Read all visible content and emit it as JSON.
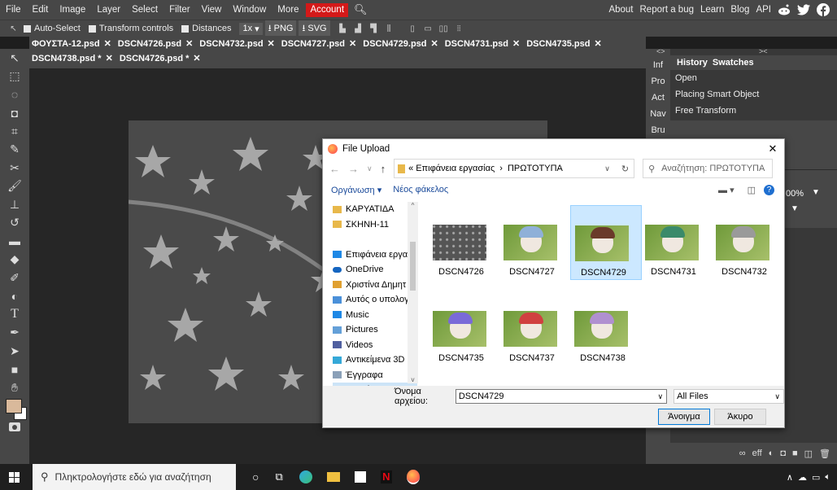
{
  "menubar": {
    "items": [
      "File",
      "Edit",
      "Image",
      "Layer",
      "Select",
      "Filter",
      "View",
      "Window",
      "More"
    ],
    "account": "Account",
    "right_items": [
      "About",
      "Report a bug",
      "Learn",
      "Blog",
      "API"
    ]
  },
  "optbar": {
    "auto_select": "Auto-Select",
    "transform_controls": "Transform controls",
    "distances": "Distances",
    "zoom": "1x",
    "png": "PNG",
    "svg": "SVG"
  },
  "tabs": {
    "row1": [
      "ΦΟΥΣΤΑ-12.psd",
      "DSCN4726.psd",
      "DSCN4732.psd",
      "DSCN4727.psd",
      "DSCN4729.psd",
      "DSCN4731.psd",
      "DSCN4735.psd"
    ],
    "row2": [
      "DSCN4738.psd *",
      "DSCN4726.psd *"
    ]
  },
  "right_panel": {
    "side_labels": [
      "Inf",
      "Pro",
      "Act",
      "Nav",
      "Bru"
    ],
    "tabs": [
      "History",
      "Swatches"
    ],
    "history": [
      "Open",
      "Placing Smart Object",
      "Free Transform"
    ],
    "zoom_fragment": "00%"
  },
  "dialog": {
    "title": "File Upload",
    "breadcrumb_prefix": "«",
    "breadcrumb": [
      "Επιφάνεια εργασίας",
      "ΠΡΩΤΟΤΥΠΑ"
    ],
    "search_placeholder": "Αναζήτηση: ΠΡΩΤΟΤΥΠΑ",
    "organize": "Οργάνωση ▾",
    "new_folder": "Νέος φάκελος",
    "tree": [
      {
        "label": "ΚΑΡΥΑΤΙΔΑ",
        "icon": "folder",
        "color": "#e8b84a"
      },
      {
        "label": "ΣΚΗΝΗ-11",
        "icon": "folder",
        "color": "#e8b84a"
      },
      {
        "label": "",
        "icon": "none",
        "color": "#ffffff"
      },
      {
        "label": "Επιφάνεια εργασί",
        "icon": "desktop",
        "color": "#1e88e5"
      },
      {
        "label": "OneDrive",
        "icon": "cloud",
        "color": "#1565c0"
      },
      {
        "label": "Χριστίνα Δημητ",
        "icon": "user",
        "color": "#e0a030"
      },
      {
        "label": "Αυτός ο υπολογ",
        "icon": "pc",
        "color": "#4a90d9"
      },
      {
        "label": "Music",
        "icon": "music",
        "color": "#1e88e5"
      },
      {
        "label": "Pictures",
        "icon": "pictures",
        "color": "#64a0d8"
      },
      {
        "label": "Videos",
        "icon": "videos",
        "color": "#5060a0"
      },
      {
        "label": "Αντικείμενα 3D",
        "icon": "3d",
        "color": "#35a8d8"
      },
      {
        "label": "Έγγραφα",
        "icon": "docs",
        "color": "#8aa0b8"
      },
      {
        "label": "Επιφάνεια εργα",
        "icon": "desktop",
        "color": "#1e88e5"
      }
    ],
    "files": [
      {
        "name": "DSCN4726",
        "kind": "stars",
        "hair": ""
      },
      {
        "name": "DSCN4727",
        "kind": "face",
        "hair": "#8fb0d8"
      },
      {
        "name": "DSCN4729",
        "kind": "face",
        "hair": "#6a3a2a"
      },
      {
        "name": "DSCN4731",
        "kind": "face",
        "hair": "#3a8a6a"
      },
      {
        "name": "DSCN4732",
        "kind": "face",
        "hair": "#9a9a9a"
      },
      {
        "name": "DSCN4735",
        "kind": "face",
        "hair": "#7a6ad8"
      },
      {
        "name": "DSCN4737",
        "kind": "face",
        "hair": "#d04040"
      },
      {
        "name": "DSCN4738",
        "kind": "face",
        "hair": "#b090d0"
      }
    ],
    "selected_file": "DSCN4729",
    "filename_label": "Όνομα αρχείου:",
    "filename_value": "DSCN4729",
    "filter": "All Files",
    "open_button": "Άνοιγμα",
    "cancel_button": "Άκυρο"
  },
  "taskbar": {
    "search_placeholder": "Πληκτρολογήστε εδώ για αναζήτηση"
  }
}
